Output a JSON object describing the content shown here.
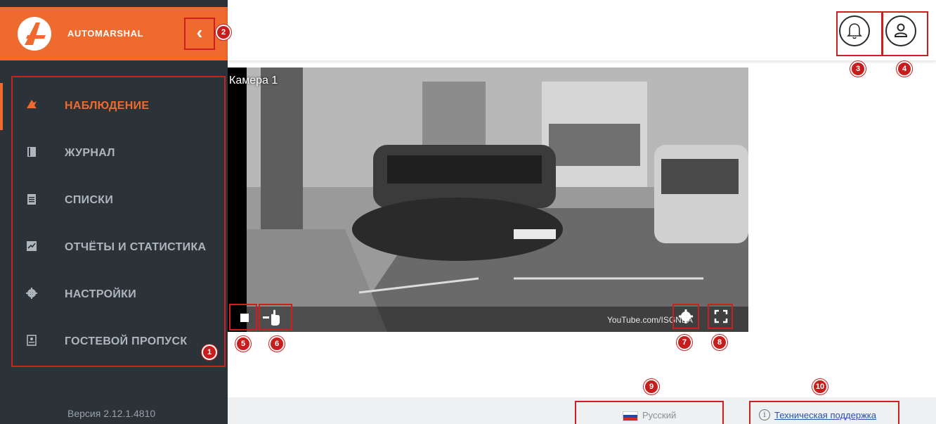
{
  "brand": {
    "name": "AUTOMARSHAL"
  },
  "sidebar": {
    "items": [
      {
        "label": "НАБЛЮДЕНИЕ",
        "icon": "surveillance-icon",
        "active": true
      },
      {
        "label": "ЖУРНАЛ",
        "icon": "journal-icon",
        "active": false
      },
      {
        "label": "СПИСКИ",
        "icon": "clipboard-list-icon",
        "active": false
      },
      {
        "label": "ОТЧЁТЫ И СТАТИСТИКА",
        "icon": "chart-icon",
        "active": false
      },
      {
        "label": "НАСТРОЙКИ",
        "icon": "gear-icon",
        "active": false
      },
      {
        "label": "ГОСТЕВОЙ ПРОПУСК",
        "icon": "guest-pass-icon",
        "active": false
      }
    ],
    "version": "Версия 2.12.1.4810"
  },
  "camera": {
    "title": "Камера 1",
    "watermark": "YouTube.com/ISGNEA"
  },
  "footer": {
    "language": "Русский",
    "support": "Техническая поддержка"
  },
  "annotations": [
    "1",
    "2",
    "3",
    "4",
    "5",
    "6",
    "7",
    "8",
    "9",
    "10"
  ],
  "colors": {
    "brand": "#ee6a2e",
    "sidebar": "#2b3238",
    "annotation": "#cc1f1f"
  }
}
